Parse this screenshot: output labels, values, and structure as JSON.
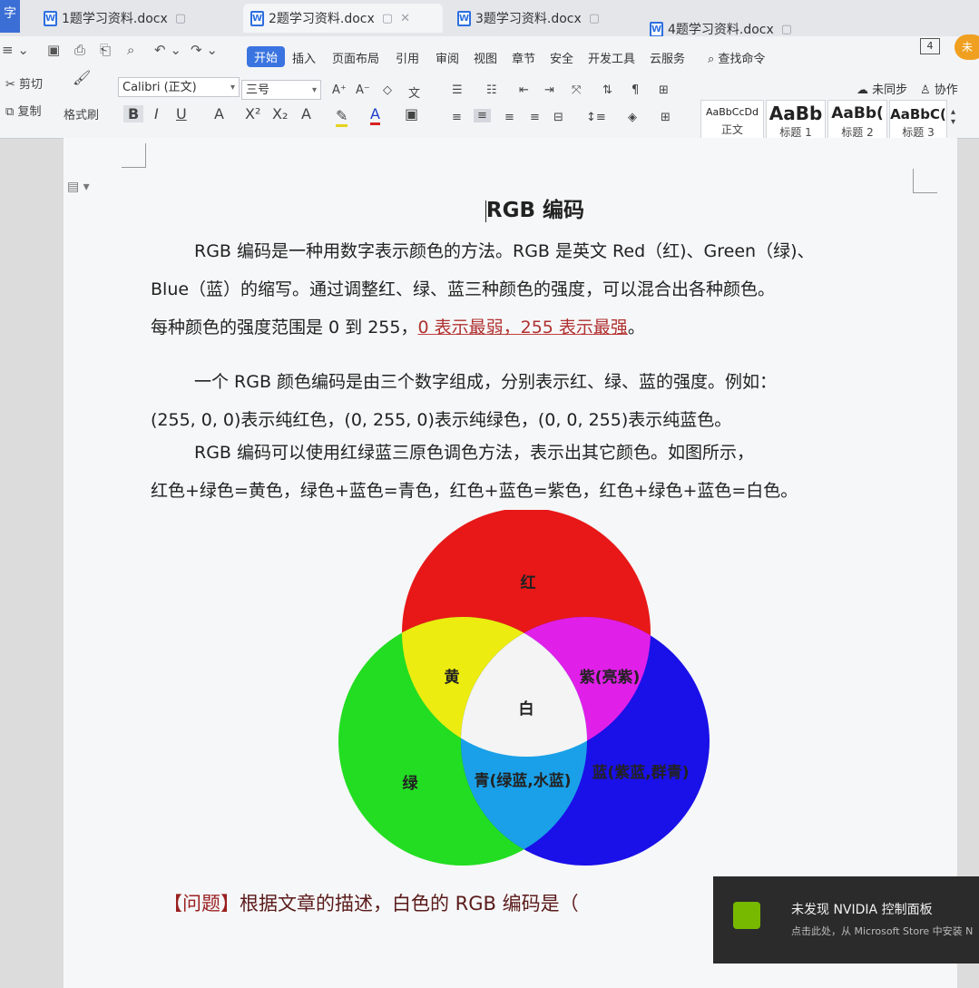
{
  "tabs": [
    {
      "label": "1题学习资料.docx"
    },
    {
      "label": "2题学习资料.docx"
    },
    {
      "label": "3题学习资料.docx"
    },
    {
      "label": "4题学习资料.docx"
    }
  ],
  "app_stub": "字",
  "window_count": "4",
  "avatar_text": "未",
  "menu": {
    "tabs": [
      "开始",
      "插入",
      "页面布局",
      "引用",
      "审阅",
      "视图",
      "章节",
      "安全",
      "开发工具",
      "云服务"
    ],
    "search": "查找命令",
    "sync": "未同步",
    "collab": "协作"
  },
  "clipboard": {
    "cut": "剪切",
    "copy": "复制",
    "format_painter": "格式刷"
  },
  "font": {
    "name": "Calibri (正文)",
    "size": "三号"
  },
  "styles": [
    {
      "sample": "AaBbCcDd",
      "name": "正文"
    },
    {
      "sample": "AaBb",
      "name": "标题 1"
    },
    {
      "sample": "AaBb(",
      "name": "标题 2"
    },
    {
      "sample": "AaBbC(",
      "name": "标题 3"
    }
  ],
  "document": {
    "title": "RGB 编码",
    "p1a": "RGB 编码是一种用数字表示颜色的方法。RGB 是英文 Red（红)、Green（绿)、",
    "p1b": "Blue（蓝）的缩写。通过调整红、绿、蓝三种颜色的强度，可以混合出各种颜色。",
    "p1c": "每种颜色的强度范围是 0 到 255，",
    "p1c_underlined": "0 表示最弱，255 表示最强",
    "p1c_end": "。",
    "p2a": "一个 RGB 颜色编码是由三个数字组成，分别表示红、绿、蓝的强度。例如：",
    "p2b": "(255, 0, 0)表示纯红色，(0, 255, 0)表示纯绿色，(0, 0, 255)表示纯蓝色。",
    "p3a": "RGB 编码可以使用红绿蓝三原色调色方法，表示出其它颜色。如图所示，",
    "p3b": "红色+绿色=黄色，绿色+蓝色=青色，红色+蓝色=紫色，红色+绿色+蓝色=白色。",
    "question_bracket": "【问题】",
    "question": "根据文章的描述，白色的 RGB 编码是（"
  },
  "venn": {
    "red": "红",
    "green": "绿",
    "blue": "蓝(紫蓝,群青)",
    "yellow": "黄",
    "magenta": "紫(亮紫)",
    "cyan": "青(绿蓝,水蓝)",
    "white": "白",
    "colors": {
      "red": "#e81818",
      "green": "#22dd22",
      "blue": "#1a10e8",
      "yellow": "#ecec10",
      "magenta": "#e020e8",
      "cyan": "#1aa0e8",
      "white": "#f4f4f4"
    }
  },
  "notification": {
    "title": "未发现 NVIDIA 控制面板",
    "body": "点击此处，从 Microsoft Store 中安装 N"
  }
}
